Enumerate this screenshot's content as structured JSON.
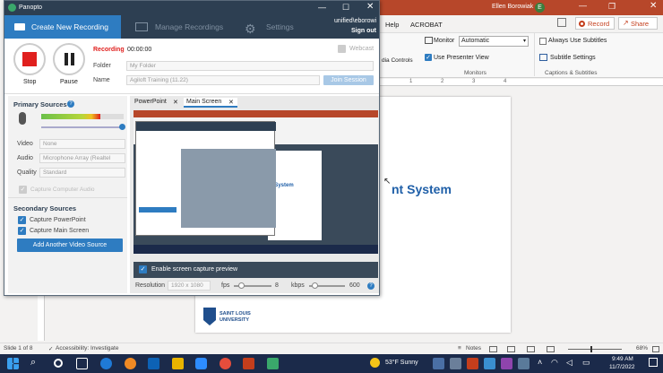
{
  "panopto": {
    "app_title": "Panopto",
    "user": "unified\\eborowi",
    "sign_out": "Sign out",
    "tabs": {
      "create": "Create New Recording",
      "manage": "Manage Recordings",
      "settings": "Settings"
    },
    "stop_label": "Stop",
    "pause_label": "Pause",
    "recording_label": "Recording",
    "recording_time": "00:00:00",
    "webcast_label": "Webcast",
    "folder_label": "Folder",
    "folder_value": "My Folder",
    "name_label": "Name",
    "name_value": "Agiloft Training (11.22)",
    "join_session": "Join Session",
    "primary_sources": "Primary Sources",
    "video_label": "Video",
    "video_value": "None",
    "audio_label": "Audio",
    "audio_value": "Microphone Array (Realtel",
    "quality_label": "Quality",
    "quality_value": "Standard",
    "capture_computer_audio": "Capture Computer Audio",
    "secondary_sources": "Secondary Sources",
    "capture_powerpoint": "Capture PowerPoint",
    "capture_main_screen": "Capture Main Screen",
    "add_video_source": "Add Another Video Source",
    "preview_tabs": [
      "PowerPoint",
      "Main Screen"
    ],
    "enable_preview": "Enable screen capture preview",
    "resolution_label": "Resolution",
    "resolution_value": "1920 x 1080",
    "fps_label": "fps",
    "fps_value": "8",
    "kbps_label": "kbps",
    "kbps_value": "600",
    "audio_level": 0.72
  },
  "powerpoint": {
    "user": "Ellen Borowiak",
    "user_initial": "E",
    "tabs": [
      "Help",
      "ACROBAT"
    ],
    "record_button": "Record",
    "share_button": "Share",
    "monitor_label": "Monitor",
    "monitor_value": "Automatic",
    "use_presenter_view": "Use Presenter View",
    "media_controls": "dia Controls",
    "group_monitors": "Monitors",
    "always_use_subtitles": "Always Use Subtitles",
    "subtitle_settings": "Subtitle Settings",
    "group_captions": "Captions & Subtitles",
    "slide_title_fragment": "nt System",
    "university_line1": "SAINT LOUIS",
    "university_line2": "UNIVERSITY",
    "ruler_numbers": [
      "1",
      "2",
      "3",
      "4"
    ],
    "status_slide": "Slide 1 of 8",
    "status_accessibility": "Accessibility: Investigate",
    "status_notes": "Notes",
    "status_zoom": "68%"
  },
  "taskbar": {
    "weather": "53°F  Sunny",
    "time": "9:49 AM",
    "date": "11/7/2022"
  }
}
